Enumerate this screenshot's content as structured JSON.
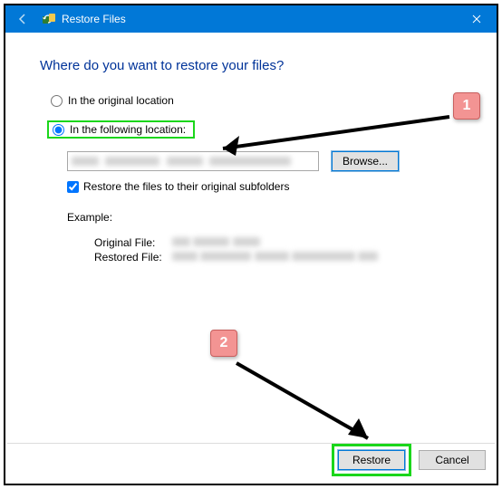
{
  "titlebar": {
    "title": "Restore Files"
  },
  "heading": "Where do you want to restore your files?",
  "options": {
    "original": "In the original location",
    "following": "In the following location:"
  },
  "browse_label": "Browse...",
  "checkbox_label": "Restore the files to their original subfolders",
  "example": {
    "heading": "Example:",
    "original_label": "Original File:",
    "restored_label": "Restored File:"
  },
  "footer": {
    "restore": "Restore",
    "cancel": "Cancel"
  },
  "callouts": {
    "one": "1",
    "two": "2"
  }
}
